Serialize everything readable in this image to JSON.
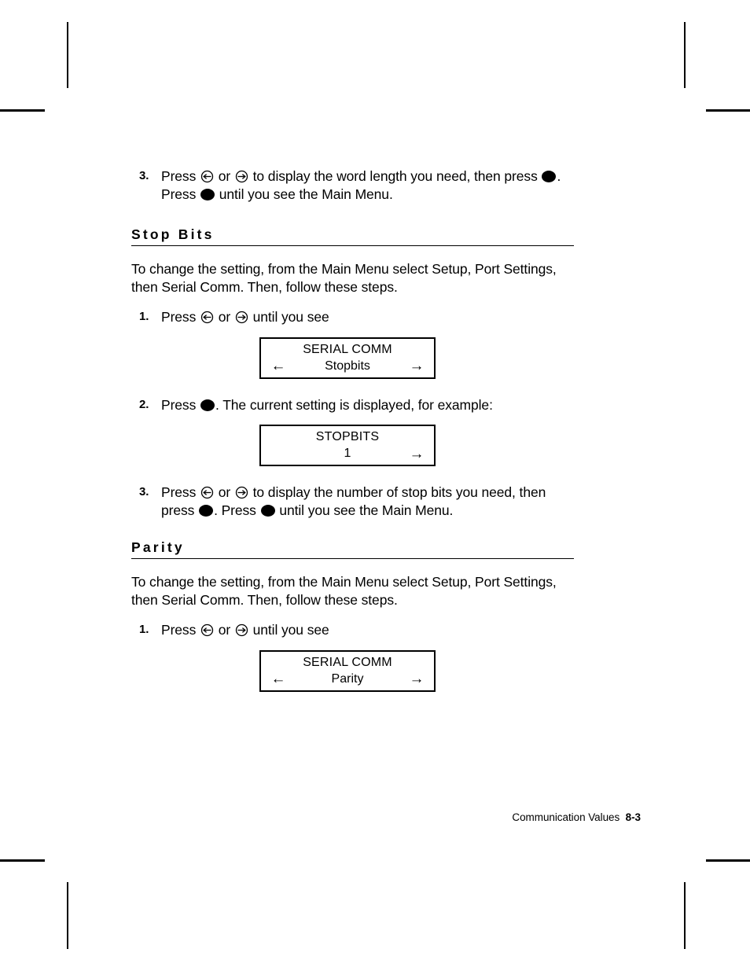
{
  "document": {
    "footer_text": "Communication Values",
    "page_number": "8-3"
  },
  "icons": {
    "left_key": "circled-left-arrow-icon",
    "right_key": "circled-right-arrow-icon",
    "enter_key": "filled-circle-enter-icon",
    "lcd_left_arrow": "←",
    "lcd_right_arrow": "→"
  },
  "top_step": {
    "number": "3.",
    "text_a": "Press ",
    "text_b": " or ",
    "text_c": " to display the word length you need, then press ",
    "text_d": ".  Press ",
    "text_e": " until you see the Main Menu."
  },
  "sections": [
    {
      "heading": "Stop Bits",
      "intro": "To change the setting, from the Main Menu select Setup, Port Settings, then Serial Comm.  Then, follow these steps.",
      "steps": [
        {
          "number": "1.",
          "text_a": "Press ",
          "text_b": " or ",
          "text_c": " until you see"
        },
        {
          "number": "2.",
          "text_a": "Press ",
          "text_b": ".   The current setting is displayed, for example:"
        },
        {
          "number": "3.",
          "text_a": "Press ",
          "text_b": " or ",
          "text_c": " to display the number of stop bits you need, then press ",
          "text_d": ".  Press ",
          "text_e": " until you see the Main Menu."
        }
      ],
      "displays": [
        {
          "line1": "SERIAL COMM",
          "line2": "Stopbits",
          "left_arrow": true,
          "right_arrow": true
        },
        {
          "line1": "STOPBITS",
          "line2": "1",
          "left_arrow": false,
          "right_arrow": true
        }
      ]
    },
    {
      "heading": "Parity",
      "intro": "To change the setting, from the Main Menu select Setup, Port Settings, then Serial Comm.  Then, follow these steps.",
      "steps": [
        {
          "number": "1.",
          "text_a": "Press ",
          "text_b": " or ",
          "text_c": " until you see"
        }
      ],
      "displays": [
        {
          "line1": "SERIAL COMM",
          "line2": "Parity",
          "left_arrow": true,
          "right_arrow": true
        }
      ]
    }
  ]
}
